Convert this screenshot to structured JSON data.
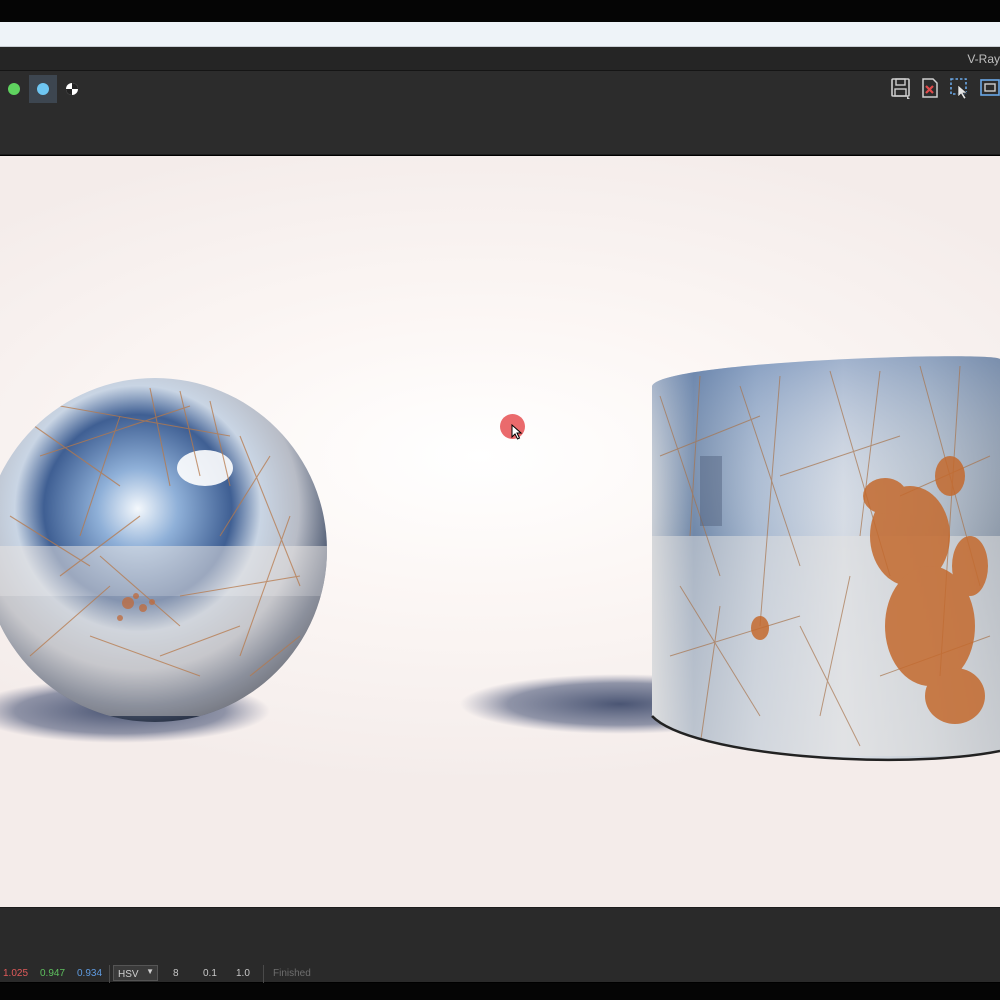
{
  "window": {
    "title": "V-Ray"
  },
  "toolbar": {
    "channels": [
      {
        "name": "green-channel",
        "color": "#5fd35f",
        "active": false
      },
      {
        "name": "blue-channel",
        "color": "#6ec6f2",
        "active": true
      },
      {
        "name": "alpha-channel",
        "active": false
      }
    ],
    "icons": [
      "save-icon",
      "clear-image-icon",
      "region-select-icon",
      "render-region-icon"
    ]
  },
  "status": {
    "r": "1.025",
    "g": "0.947",
    "b": "0.934",
    "r_color": "#e05a5a",
    "g_color": "#5ec05e",
    "b_color": "#5f9be0",
    "color_mode": "HSV",
    "bits": "8",
    "min": "0.1",
    "max": "1.0",
    "state": "Finished"
  }
}
